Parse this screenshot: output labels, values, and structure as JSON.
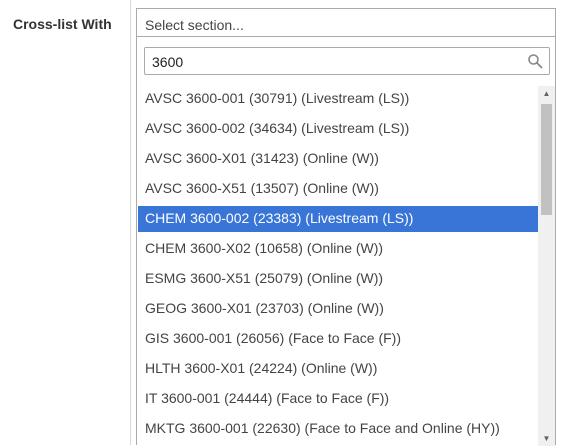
{
  "field": {
    "label": "Cross-list With",
    "select_placeholder": "Select section..."
  },
  "search": {
    "value": "3600",
    "icon": "search-icon"
  },
  "results": [
    {
      "label": "AVSC 3600-001 (30791) (Livestream (LS))",
      "highlighted": false
    },
    {
      "label": "AVSC 3600-002 (34634) (Livestream (LS))",
      "highlighted": false
    },
    {
      "label": "AVSC 3600-X01 (31423) (Online (W))",
      "highlighted": false
    },
    {
      "label": "AVSC 3600-X51 (13507) (Online (W))",
      "highlighted": false
    },
    {
      "label": "CHEM 3600-002 (23383) (Livestream (LS))",
      "highlighted": true
    },
    {
      "label": "CHEM 3600-X02 (10658) (Online (W))",
      "highlighted": false
    },
    {
      "label": "ESMG 3600-X51 (25079) (Online (W))",
      "highlighted": false
    },
    {
      "label": "GEOG 3600-X01 (23703) (Online (W))",
      "highlighted": false
    },
    {
      "label": "GIS 3600-001 (26056) (Face to Face (F))",
      "highlighted": false
    },
    {
      "label": "HLTH 3600-X01 (24224) (Online (W))",
      "highlighted": false
    },
    {
      "label": "IT 3600-001 (24444) (Face to Face (F))",
      "highlighted": false
    },
    {
      "label": "MKTG 3600-001 (22630) (Face to Face and Online (HY))",
      "highlighted": false
    }
  ],
  "colors": {
    "highlight": "#3875d7",
    "highlight_text": "#ffffff",
    "item_text": "#444444",
    "border": "#aaaaaa"
  }
}
